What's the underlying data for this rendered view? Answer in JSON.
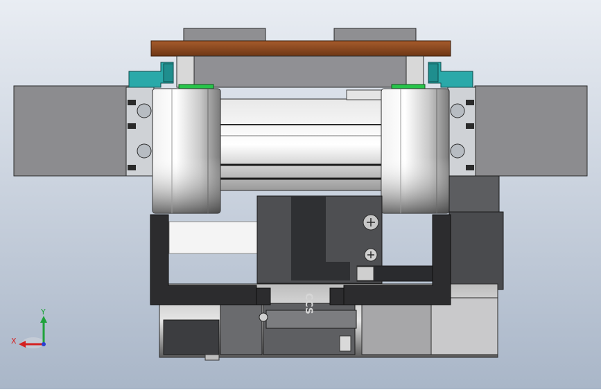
{
  "viewport": {
    "background_top": "#e9edf3",
    "background_bottom": "#a9b6c8"
  },
  "model": {
    "engraved_text": "CCS",
    "colors": {
      "wood_plate": "#8a4a22",
      "teal_clamp": "#2aa9a9",
      "green_seal": "#27c44a",
      "dark_bracket": "#2c2c2e",
      "gray_block": "#8c8c8f"
    }
  },
  "triad": {
    "x_label": "X",
    "y_label": "Y",
    "x_color": "#d42020",
    "y_color": "#1fa23a",
    "z_color": "#2a3fd1"
  }
}
